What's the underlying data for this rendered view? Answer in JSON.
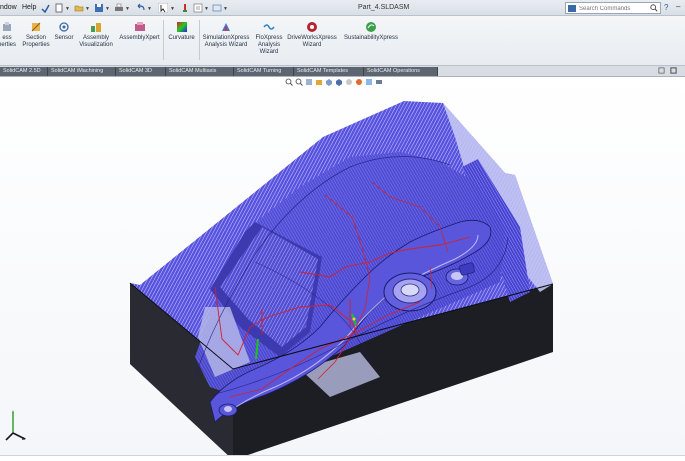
{
  "window": {
    "menu": {
      "window": "ndow",
      "help": "Help"
    },
    "doc_title": "Part_4.SLDASM",
    "search": {
      "placeholder": "Search Commands"
    },
    "help_glyph": "?",
    "min_glyph": "–"
  },
  "ribbon": {
    "buttons": [
      {
        "line1": "ess",
        "line2": "perties",
        "icon": "mass-properties-icon"
      },
      {
        "line1": "Section",
        "line2": "Properties",
        "icon": "section-properties-icon"
      },
      {
        "line1": "Sensor",
        "line2": "",
        "icon": "sensor-icon"
      },
      {
        "line1": "Assembly",
        "line2": "Visualization",
        "icon": "assembly-visualization-icon"
      },
      {
        "line1": "AssemblyXpert",
        "line2": "",
        "icon": "assemblyxpert-icon"
      },
      {
        "line1": "Curvature",
        "line2": "",
        "icon": "curvature-icon"
      },
      {
        "line1": "SimulationXpress",
        "line2": "Analysis Wizard",
        "icon": "simulationxpress-icon"
      },
      {
        "line1": "FloXpress",
        "line2": "Analysis",
        "line3": "Wizard",
        "icon": "floxpress-icon"
      },
      {
        "line1": "DriveWorksXpress",
        "line2": "Wizard",
        "icon": "driveworksxpress-icon"
      },
      {
        "line1": "SustainabilityXpress",
        "line2": "",
        "icon": "sustainabilityxpress-icon"
      }
    ]
  },
  "tabs": [
    "SolidCAM 2.5D",
    "SolidCAM iMachining",
    "SolidCAM 3D",
    "SolidCAM Multiaxis",
    "SolidCAM Turning",
    "SolidCAM Templates",
    "SolidCAM Operations"
  ],
  "colors": {
    "accent": "#2b5c9e",
    "toolpath_blue": "#4a47d8",
    "toolpath_red": "#d4202a",
    "block_dark": "#1d1d24",
    "block_side": "#2a2a33",
    "tab_bg": "#5d6670"
  }
}
